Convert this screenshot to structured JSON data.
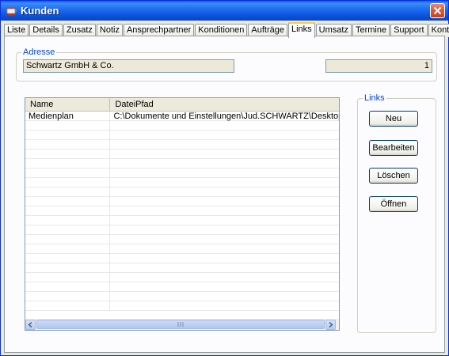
{
  "window": {
    "title": "Kunden"
  },
  "tabs": [
    {
      "label": "Liste"
    },
    {
      "label": "Details"
    },
    {
      "label": "Zusatz"
    },
    {
      "label": "Notiz"
    },
    {
      "label": "Ansprechpartner"
    },
    {
      "label": "Konditionen"
    },
    {
      "label": "Aufträge"
    },
    {
      "label": "Links",
      "active": true
    },
    {
      "label": "Umsatz"
    },
    {
      "label": "Termine"
    },
    {
      "label": "Support"
    },
    {
      "label": "Kontakt"
    }
  ],
  "address": {
    "legend": "Adresse",
    "company": "Schwartz GmbH  & Co.",
    "number": "1"
  },
  "links_table": {
    "columns": [
      "Name",
      "DateiPfad"
    ],
    "rows": [
      {
        "name": "Medienplan",
        "path": "C:\\Dokumente und Einstellungen\\Jud.SCHWARTZ\\Desktop\\au..."
      }
    ]
  },
  "links_panel": {
    "legend": "Links",
    "new_label": "Neu",
    "edit_label": "Bearbeiten",
    "delete_label": "Löschen",
    "open_label": "Öffnen"
  },
  "colors": {
    "accent": "#0046d5",
    "titlebar": "#0a4fd8",
    "active_tab": "#ffc83c"
  },
  "icons": {
    "app": "app-cup-icon",
    "close": "close-icon",
    "scroll_left": "chevron-left-icon",
    "scroll_right": "chevron-right-icon",
    "grip": "scroll-grip-icon"
  }
}
